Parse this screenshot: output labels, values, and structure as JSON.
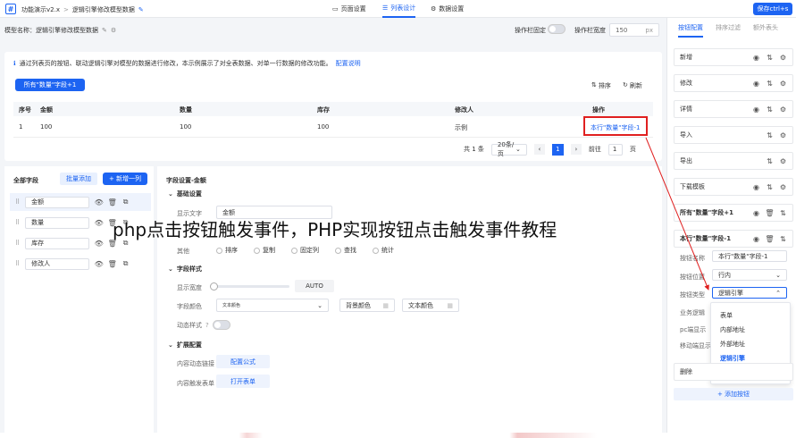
{
  "topbar": {
    "app": "功能演示v2.x",
    "sep": ">",
    "page": "逻辑引擎修改模型数据",
    "tabs": [
      {
        "label": "页面设置"
      },
      {
        "label": "列表设计"
      },
      {
        "label": "数据设置"
      }
    ],
    "save": "保存ctrl+s"
  },
  "subbar": {
    "model_name": "模型名称：逻辑引擎修改模型数据",
    "fix_label": "操作栏固定",
    "width_label": "操作栏宽度",
    "width_value": "150",
    "width_unit": "px"
  },
  "preview": {
    "info": "通过列表页的按钮、联动逻辑引擎对模型的数据进行修改，本示例展示了对全表数据、对单一行数据的修改功能。",
    "info_link": "配置说明",
    "top_button": "所有\"数量\"字段+1",
    "sort": "排序",
    "refresh": "刷新",
    "table": {
      "headers": [
        "序号",
        "金额",
        "数量",
        "库存",
        "修改人",
        "操作"
      ],
      "rows": [
        [
          "1",
          "100",
          "100",
          "100",
          "示例",
          "本行\"数量\"字段-1"
        ]
      ]
    },
    "pager": {
      "total": "共 1 条",
      "size": "20条/页",
      "page": "1",
      "goto": "前往",
      "goto_value": "1",
      "goto_unit": "页"
    }
  },
  "fields": {
    "title": "全部字段",
    "batch": "批量添加",
    "add": "+ 新增一列",
    "items": [
      {
        "name": "金额"
      },
      {
        "name": "数量"
      },
      {
        "name": "库存"
      },
      {
        "name": "修改人"
      }
    ]
  },
  "settings": {
    "title": "字段设置-金额",
    "basic": "基础设置",
    "label_key": "显示文字",
    "label_value": "金额",
    "other_key": "其他",
    "options": [
      "排序",
      "复制",
      "固定列",
      "查找",
      "统计"
    ],
    "style": "字段样式",
    "width_key": "显示宽度",
    "width_value": "AUTO",
    "color_key": "字段颜色",
    "color_value": "文本颜色",
    "bg_color": "背景颜色",
    "text_color": "文本颜色",
    "dynamic_key": "动态样式",
    "ext": "扩展配置",
    "link_key": "内容动态链接",
    "link_btn": "配置公式",
    "form_key": "内容触发表单",
    "form_btn": "打开表单"
  },
  "overlay_title": "php点击按钮触发事件，PHP实现按钮点击触发事件教程",
  "right": {
    "tabs": [
      "按钮配置",
      "排序过滤",
      "额外表头"
    ],
    "buttons": [
      {
        "label": "新增"
      },
      {
        "label": "修改"
      },
      {
        "label": "详情"
      },
      {
        "label": "导入"
      },
      {
        "label": "导出"
      },
      {
        "label": "下载模板"
      },
      {
        "label": "所有\"数量\"字段+1"
      },
      {
        "label": "本行\"数量\"字段-1"
      }
    ],
    "form": {
      "name_key": "按钮名称",
      "name_value": "本行\"数量\"字段-1",
      "pos_key": "按钮位置",
      "pos_value": "行内",
      "type_key": "按钮类型",
      "type_value": "逻辑引擎",
      "logic_key": "业务逻辑",
      "pc_key": "pc端显示",
      "mobile_key": "移动端显示"
    },
    "dropdown": [
      "表单",
      "内部地址",
      "外部地址",
      "逻辑引擎",
      "列表"
    ],
    "delete": "删除",
    "add_btn": "+ 添加按钮"
  },
  "colors": {
    "accent": "#1d64f2",
    "highlight": "#e02020"
  }
}
